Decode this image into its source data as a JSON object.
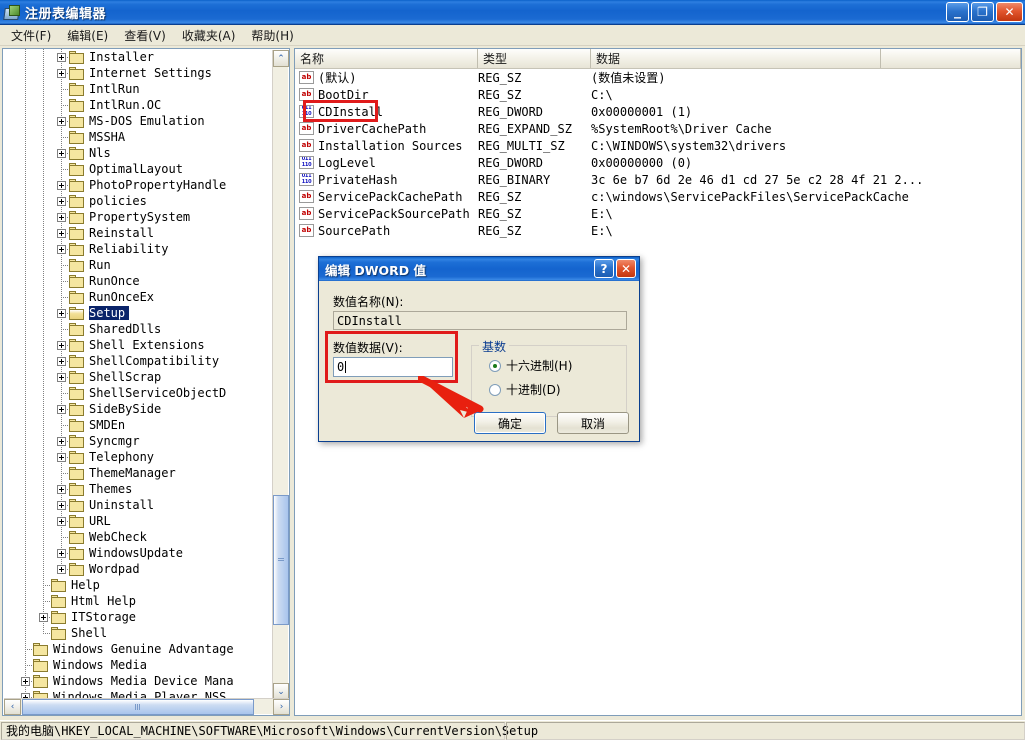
{
  "window": {
    "title": "注册表编辑器",
    "icon": "registry-editor-icon",
    "buttons": {
      "minimize": "_",
      "restore": "❐",
      "close": "✕"
    }
  },
  "menubar": {
    "items": [
      {
        "label": "文件(F)"
      },
      {
        "label": "编辑(E)"
      },
      {
        "label": "查看(V)"
      },
      {
        "label": "收藏夹(A)"
      },
      {
        "label": "帮助(H)"
      }
    ]
  },
  "tree": {
    "nodes": [
      {
        "label": "Installer",
        "depth": 3,
        "expandable": true,
        "open": false
      },
      {
        "label": "Internet Settings",
        "depth": 3,
        "expandable": true,
        "open": false
      },
      {
        "label": "IntlRun",
        "depth": 3,
        "expandable": false,
        "open": false
      },
      {
        "label": "IntlRun.OC",
        "depth": 3,
        "expandable": false,
        "open": false
      },
      {
        "label": "MS-DOS Emulation",
        "depth": 3,
        "expandable": true,
        "open": false
      },
      {
        "label": "MSSHA",
        "depth": 3,
        "expandable": false,
        "open": false
      },
      {
        "label": "Nls",
        "depth": 3,
        "expandable": true,
        "open": false
      },
      {
        "label": "OptimalLayout",
        "depth": 3,
        "expandable": false,
        "open": false
      },
      {
        "label": "PhotoPropertyHandle",
        "depth": 3,
        "expandable": true,
        "open": false
      },
      {
        "label": "policies",
        "depth": 3,
        "expandable": true,
        "open": false
      },
      {
        "label": "PropertySystem",
        "depth": 3,
        "expandable": true,
        "open": false
      },
      {
        "label": "Reinstall",
        "depth": 3,
        "expandable": true,
        "open": false
      },
      {
        "label": "Reliability",
        "depth": 3,
        "expandable": true,
        "open": false
      },
      {
        "label": "Run",
        "depth": 3,
        "expandable": false,
        "open": false
      },
      {
        "label": "RunOnce",
        "depth": 3,
        "expandable": false,
        "open": false
      },
      {
        "label": "RunOnceEx",
        "depth": 3,
        "expandable": false,
        "open": false
      },
      {
        "label": "Setup",
        "depth": 3,
        "expandable": true,
        "open": true,
        "selected": true
      },
      {
        "label": "SharedDlls",
        "depth": 3,
        "expandable": false,
        "open": false
      },
      {
        "label": "Shell Extensions",
        "depth": 3,
        "expandable": true,
        "open": false
      },
      {
        "label": "ShellCompatibility",
        "depth": 3,
        "expandable": true,
        "open": false
      },
      {
        "label": "ShellScrap",
        "depth": 3,
        "expandable": true,
        "open": false
      },
      {
        "label": "ShellServiceObjectD",
        "depth": 3,
        "expandable": false,
        "open": false
      },
      {
        "label": "SideBySide",
        "depth": 3,
        "expandable": true,
        "open": false
      },
      {
        "label": "SMDEn",
        "depth": 3,
        "expandable": false,
        "open": false
      },
      {
        "label": "Syncmgr",
        "depth": 3,
        "expandable": true,
        "open": false
      },
      {
        "label": "Telephony",
        "depth": 3,
        "expandable": true,
        "open": false
      },
      {
        "label": "ThemeManager",
        "depth": 3,
        "expandable": false,
        "open": false
      },
      {
        "label": "Themes",
        "depth": 3,
        "expandable": true,
        "open": false
      },
      {
        "label": "Uninstall",
        "depth": 3,
        "expandable": true,
        "open": false
      },
      {
        "label": "URL",
        "depth": 3,
        "expandable": true,
        "open": false
      },
      {
        "label": "WebCheck",
        "depth": 3,
        "expandable": false,
        "open": false
      },
      {
        "label": "WindowsUpdate",
        "depth": 3,
        "expandable": true,
        "open": false
      },
      {
        "label": "Wordpad",
        "depth": 3,
        "expandable": true,
        "open": false
      },
      {
        "label": "Help",
        "depth": 2,
        "expandable": false,
        "open": false
      },
      {
        "label": "Html Help",
        "depth": 2,
        "expandable": false,
        "open": false
      },
      {
        "label": "ITStorage",
        "depth": 2,
        "expandable": true,
        "open": false
      },
      {
        "label": "Shell",
        "depth": 2,
        "expandable": false,
        "open": false
      },
      {
        "label": "Windows Genuine Advantage",
        "depth": 1,
        "expandable": false,
        "open": false
      },
      {
        "label": "Windows Media",
        "depth": 1,
        "expandable": false,
        "open": false
      },
      {
        "label": "Windows Media Device Mana",
        "depth": 1,
        "expandable": true,
        "open": false
      },
      {
        "label": "Windows Media Player NSS",
        "depth": 1,
        "expandable": true,
        "open": false
      }
    ],
    "scroll_up_arrow": "⌃",
    "scroll_down_arrow": "⌄",
    "scroll_left_arrow": "‹",
    "scroll_right_arrow": "›"
  },
  "list": {
    "columns": [
      {
        "label": "名称"
      },
      {
        "label": "类型"
      },
      {
        "label": "数据"
      }
    ],
    "rows": [
      {
        "name": "(默认)",
        "icon": "string-value-icon",
        "type": "REG_SZ",
        "data": "(数值未设置)"
      },
      {
        "name": "BootDir",
        "icon": "string-value-icon",
        "type": "REG_SZ",
        "data": "C:\\"
      },
      {
        "name": "CDInstall",
        "icon": "binary-value-icon",
        "type": "REG_DWORD",
        "data": "0x00000001  (1)"
      },
      {
        "name": "DriverCachePath",
        "icon": "string-value-icon",
        "type": "REG_EXPAND_SZ",
        "data": "%SystemRoot%\\Driver Cache"
      },
      {
        "name": "Installation Sources",
        "icon": "string-value-icon",
        "type": "REG_MULTI_SZ",
        "data": "C:\\WINDOWS\\system32\\drivers"
      },
      {
        "name": "LogLevel",
        "icon": "binary-value-icon",
        "type": "REG_DWORD",
        "data": "0x00000000  (0)"
      },
      {
        "name": "PrivateHash",
        "icon": "binary-value-icon",
        "type": "REG_BINARY",
        "data": "3c 6e b7 6d 2e 46 d1 cd 27 5e c2 28 4f 21 2..."
      },
      {
        "name": "ServicePackCachePath",
        "icon": "string-value-icon",
        "type": "REG_SZ",
        "data": "c:\\windows\\ServicePackFiles\\ServicePackCache"
      },
      {
        "name": "ServicePackSourcePath",
        "icon": "string-value-icon",
        "type": "REG_SZ",
        "data": "E:\\"
      },
      {
        "name": "SourcePath",
        "icon": "string-value-icon",
        "type": "REG_SZ",
        "data": "E:\\"
      }
    ],
    "string_icon_text": "ab",
    "binary_icon_top": "011",
    "binary_icon_bottom": "110"
  },
  "dialog": {
    "title": "编辑 DWORD 值",
    "help_button": "?",
    "close_button": "✕",
    "name_label": "数值名称(N):",
    "name_value": "CDInstall",
    "data_label": "数值数据(V):",
    "data_value": "0",
    "base_group_title": "基数",
    "radios": [
      {
        "label": "十六进制(H)",
        "selected": true
      },
      {
        "label": "十进制(D)",
        "selected": false
      }
    ],
    "ok_button": "确定",
    "cancel_button": "取消"
  },
  "statusbar": {
    "path": "我的电脑\\HKEY_LOCAL_MACHINE\\SOFTWARE\\Microsoft\\Windows\\CurrentVersion\\Setup"
  },
  "annotations": {
    "highlight_color": "#e01b1b",
    "boxes": [
      {
        "name": "cdinstall-row-highlight"
      },
      {
        "name": "value-data-field-highlight"
      }
    ],
    "arrow": {
      "name": "ok-button-arrow"
    }
  }
}
